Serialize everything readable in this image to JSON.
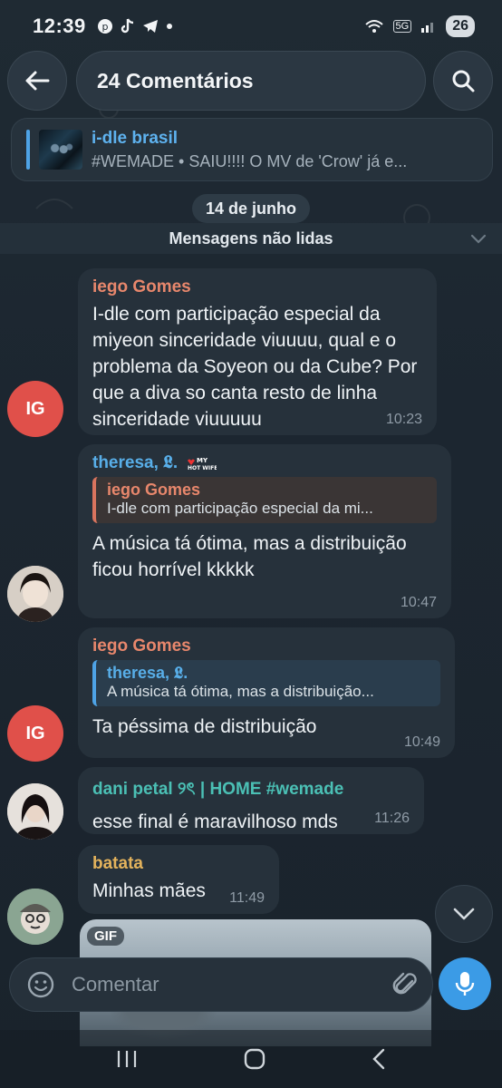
{
  "status_bar": {
    "time": "12:39",
    "battery": "26",
    "network": "5G"
  },
  "header": {
    "title": "24 Comentários"
  },
  "pinned": {
    "title": "i-dle brasil",
    "subtitle": "#WEMADE • SAIU!!!! O MV de 'Crow' já e..."
  },
  "date_chip": "14 de junho",
  "unread_label": "Mensagens não lidas",
  "messages": [
    {
      "sender": "iego Gomes",
      "avatar_initials": "IG",
      "text": "I-dle com participação especial da miyeon sinceridade viuuuu, qual e o problema da Soyeon ou da Cube? Por que a diva so canta resto de linha sinceridade viuuuuu",
      "time": "10:23"
    },
    {
      "sender": "theresa, 𝕷.",
      "reply_name": "iego Gomes",
      "reply_text": "I-dle com participação especial da mi...",
      "text": "A música tá ótima, mas a distribuição ficou horrível kkkkk",
      "time": "10:47"
    },
    {
      "sender": "iego Gomes",
      "avatar_initials": "IG",
      "reply_name": "theresa, 𝕷.",
      "reply_text": "A música tá ótima, mas a distribuição...",
      "text": "Ta péssima de distribuição",
      "time": "10:49"
    },
    {
      "sender": "dani petal ୨ৎ | HOME #wemade",
      "text": "esse final é maravilhoso mds",
      "time": "11:26"
    },
    {
      "sender": "batata",
      "text": "Minhas mães",
      "time": "11:49"
    }
  ],
  "gif_label": "GIF",
  "input": {
    "placeholder": "Comentar"
  },
  "colors": {
    "accent": "#3b9be6",
    "avatar_red": "#e0504a",
    "bubble": "#26313b"
  }
}
